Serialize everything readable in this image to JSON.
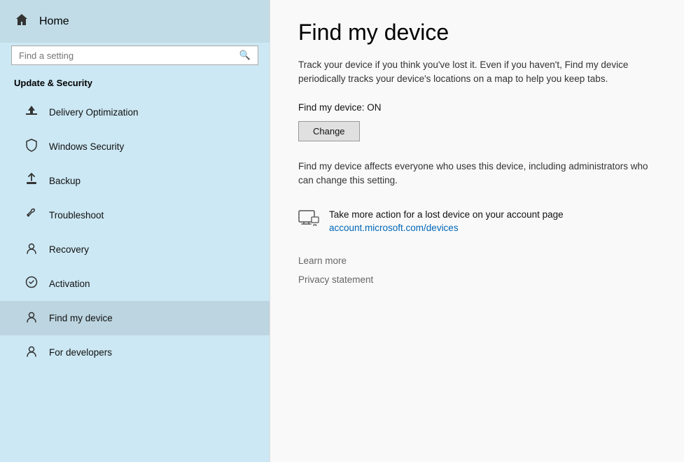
{
  "sidebar": {
    "home_label": "Home",
    "search_placeholder": "Find a setting",
    "section_title": "Update & Security",
    "nav_items": [
      {
        "id": "delivery-optimization",
        "label": "Delivery Optimization",
        "icon": "delivery-icon"
      },
      {
        "id": "windows-security",
        "label": "Windows Security",
        "icon": "shield-icon"
      },
      {
        "id": "backup",
        "label": "Backup",
        "icon": "backup-icon"
      },
      {
        "id": "troubleshoot",
        "label": "Troubleshoot",
        "icon": "troubleshoot-icon"
      },
      {
        "id": "recovery",
        "label": "Recovery",
        "icon": "recovery-icon"
      },
      {
        "id": "activation",
        "label": "Activation",
        "icon": "activation-icon"
      },
      {
        "id": "find-my-device",
        "label": "Find my device",
        "icon": "find-device-icon"
      },
      {
        "id": "for-developers",
        "label": "For developers",
        "icon": "developers-icon"
      }
    ]
  },
  "main": {
    "page_title": "Find my device",
    "description": "Track your device if you think you've lost it. Even if you haven't, Find my device periodically tracks your device's locations on a map to help you keep tabs.",
    "status_label": "Find my device: ON",
    "change_button": "Change",
    "affects_text": "Find my device affects everyone who uses this device, including administrators who can change this setting.",
    "action_text": "Take more action for a lost device on your account page",
    "action_link": "account.microsoft.com/devices",
    "learn_more": "Learn more",
    "privacy_statement": "Privacy statement"
  },
  "icons": {
    "home": "⌂",
    "search": "⚲",
    "delivery": "⬆",
    "shield": "🛡",
    "backup": "⬆",
    "troubleshoot": "🔧",
    "recovery": "♻",
    "activation": "⊙",
    "find_device": "📍",
    "developers": "⚙",
    "device_screen": "🖥"
  },
  "colors": {
    "sidebar_bg": "#cce8f4",
    "accent_blue": "#0067b8",
    "text_dark": "#111111",
    "text_muted": "#666666"
  }
}
